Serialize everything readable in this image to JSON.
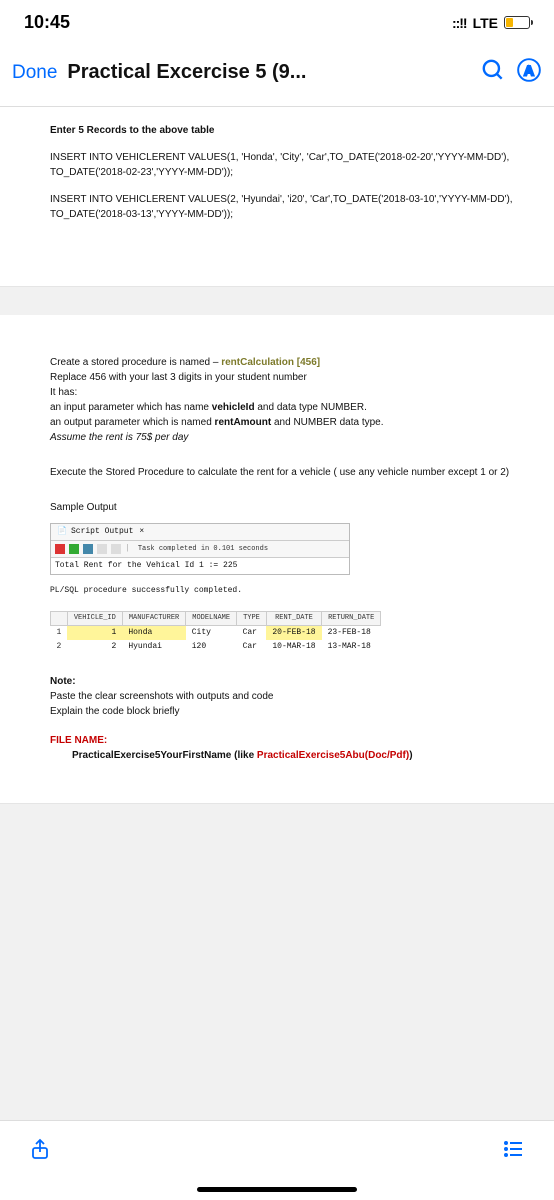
{
  "statusbar": {
    "time": "10:45",
    "network": "LTE"
  },
  "nav": {
    "done": "Done",
    "title": "Practical Excercise 5 (9..."
  },
  "sheet1": {
    "heading": "Enter 5 Records to the above table",
    "sql1": "INSERT INTO VEHICLERENT VALUES(1, 'Honda', 'City', 'Car',TO_DATE('2018-02-20','YYYY-MM-DD'), TO_DATE('2018-02-23','YYYY-MM-DD'));",
    "sql2": "INSERT INTO VEHICLERENT VALUES(2, 'Hyundai', 'i20', 'Car',TO_DATE('2018-03-10','YYYY-MM-DD'), TO_DATE('2018-03-13','YYYY-MM-DD'));"
  },
  "sheet2": {
    "p1_a": "Create a stored procedure is named – ",
    "p1_b": "rentCalculation [456]",
    "p2": "Replace 456 with your last 3 digits in your student number",
    "p3": "It has:",
    "p4_a": "an input parameter which has name ",
    "p4_b": "vehicleId",
    "p4_c": " and data type NUMBER.",
    "p5_a": "an output parameter which is named ",
    "p5_b": "rentAmount",
    "p5_c": " and NUMBER data type.",
    "p6": "Assume the rent is 75$ per day",
    "p7": "Execute the Stored Procedure to calculate the rent for a vehicle ( use any vehicle number except 1 or 2)",
    "sample_label": "Sample Output",
    "script_tab": "Script Output",
    "task_msg": "Task completed in 0.101 seconds",
    "total_line": "Total Rent for the Vehical Id 1 := 225",
    "plsql": "PL/SQL procedure successfully completed.",
    "table": {
      "headers": [
        "VEHICLE_ID",
        "MANUFACTURER",
        "MODELNAME",
        "TYPE",
        "RENT_DATE",
        "RETURN_DATE"
      ],
      "rows": [
        {
          "n": "1",
          "id": "1",
          "man": "Honda",
          "model": "City",
          "type": "Car",
          "rent": "20-FEB-18",
          "ret": "23-FEB-18",
          "hl": true
        },
        {
          "n": "2",
          "id": "2",
          "man": "Hyundai",
          "model": "i20",
          "type": "Car",
          "rent": "10-MAR-18",
          "ret": "13-MAR-18",
          "hl": false
        }
      ]
    },
    "note_h": "Note:",
    "note1": "Paste the clear screenshots with outputs and code",
    "note2": "Explain the code block briefly",
    "file_label": "FILE NAME:",
    "file_a": "PracticalExercise5YourFirstName (like ",
    "file_b": "PracticalExercise5Abu(Doc/Pdf)",
    "file_c": ")"
  }
}
